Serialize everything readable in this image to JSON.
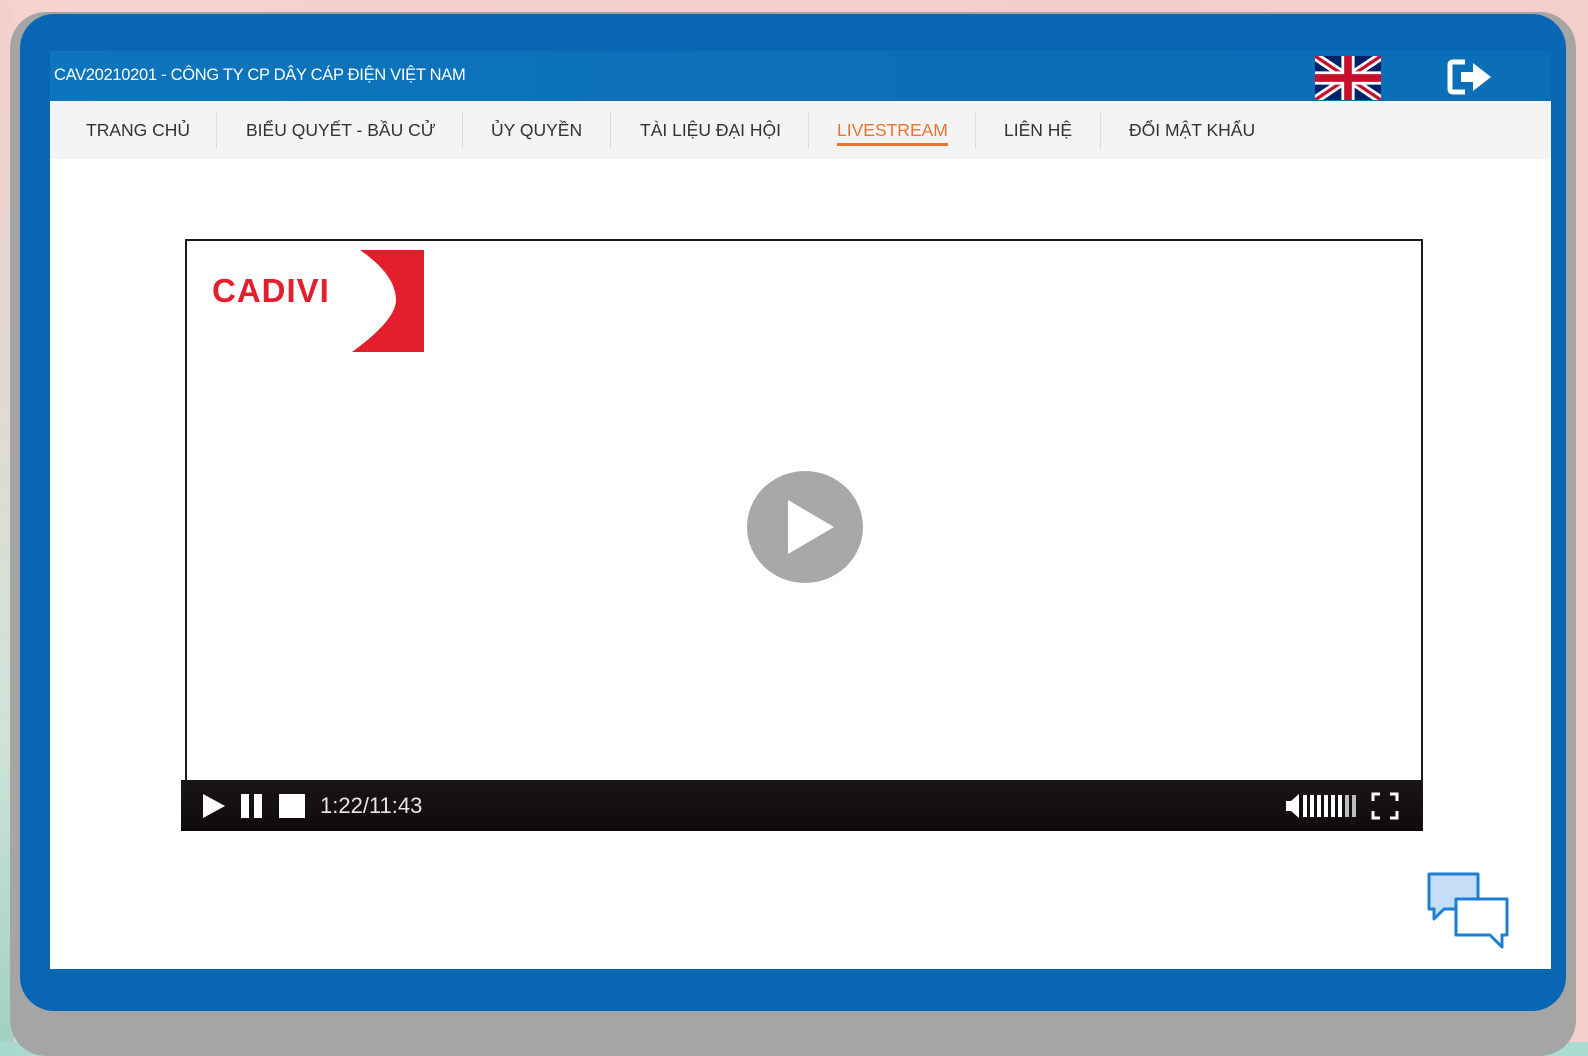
{
  "header": {
    "title": "CAV20210201 - CÔNG TY CP DÂY CÁP ĐIỆN VIỆT NAM",
    "language_icon": "uk-flag-icon",
    "logout_icon": "logout-icon"
  },
  "nav": {
    "items": [
      {
        "label": "TRANG CHỦ",
        "active": false
      },
      {
        "label": "BIỂU QUYẾT - BẦU CỬ",
        "active": false
      },
      {
        "label": "ỦY QUYỀN",
        "active": false
      },
      {
        "label": "TÀI LIỆU ĐẠI HỘI",
        "active": false
      },
      {
        "label": "LIVESTREAM",
        "active": true
      },
      {
        "label": "LIÊN HỆ",
        "active": false
      },
      {
        "label": "ĐỔI MẬT KHẨU",
        "active": false
      }
    ]
  },
  "player": {
    "logo_text": "CADIVI",
    "time": "1:22/11:43",
    "progress": 0.117,
    "volume_level": 0.75
  },
  "colors": {
    "device_blue": "#0966b4",
    "topbar_blue": "#0d75bd",
    "active_nav": "#e8752f",
    "logo_red": "#e31e2d"
  },
  "chat_icon": "chat-bubbles-icon"
}
